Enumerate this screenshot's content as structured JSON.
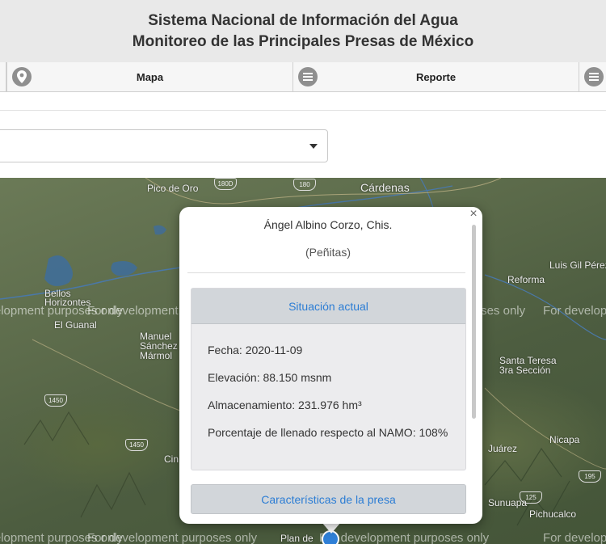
{
  "header": {
    "line1": "Sistema Nacional de Información del Agua",
    "line2": "Monitoreo de las Principales Presas de México"
  },
  "nav": {
    "mapa_label": "Mapa",
    "reporte_label": "Reporte",
    "mapa_icon": "map-pin-icon",
    "reporte_icon": "menu-icon"
  },
  "select": {
    "value": ""
  },
  "map": {
    "labels": {
      "pico_de_oro": "Pico de Oro",
      "cardenas": "Cárdenas",
      "luis_gil": "Luis Gil Pérez",
      "reforma": "Reforma",
      "bellos_horizontes": "Bellos\nHorizontes",
      "el_guanal": "El Guanal",
      "manuel_sanchez": "Manuel\nSánchez\nMármol",
      "santa_teresa": "Santa Teresa\n3ra Sección",
      "juarez": "Juárez",
      "nicapa": "Nicapa",
      "pichucalco": "Pichucalco",
      "sunuapa": "Sunuapa",
      "plan_de": "Plan de",
      "cin": "Cin"
    },
    "shields": [
      "180D",
      "180",
      "1450",
      "1450",
      "195",
      "125"
    ],
    "watermark": "For development purposes only"
  },
  "popup": {
    "title": "Ángel Albino Corzo, Chis.",
    "subtitle": "(Peñitas)",
    "section1": "Situación actual",
    "fecha": "Fecha: 2020-11-09",
    "elevacion": "Elevación: 88.150 msnm",
    "almacenamiento": "Almacenamiento: 231.976 hm³",
    "porcentaje": "Porcentaje de llenado respecto al NAMO: 108%",
    "section2": "Características de la presa",
    "close_symbol": "×"
  },
  "colors": {
    "link": "#2c7dd4",
    "header_bg": "#e9e9e9",
    "marker": "#2f7fd6"
  }
}
